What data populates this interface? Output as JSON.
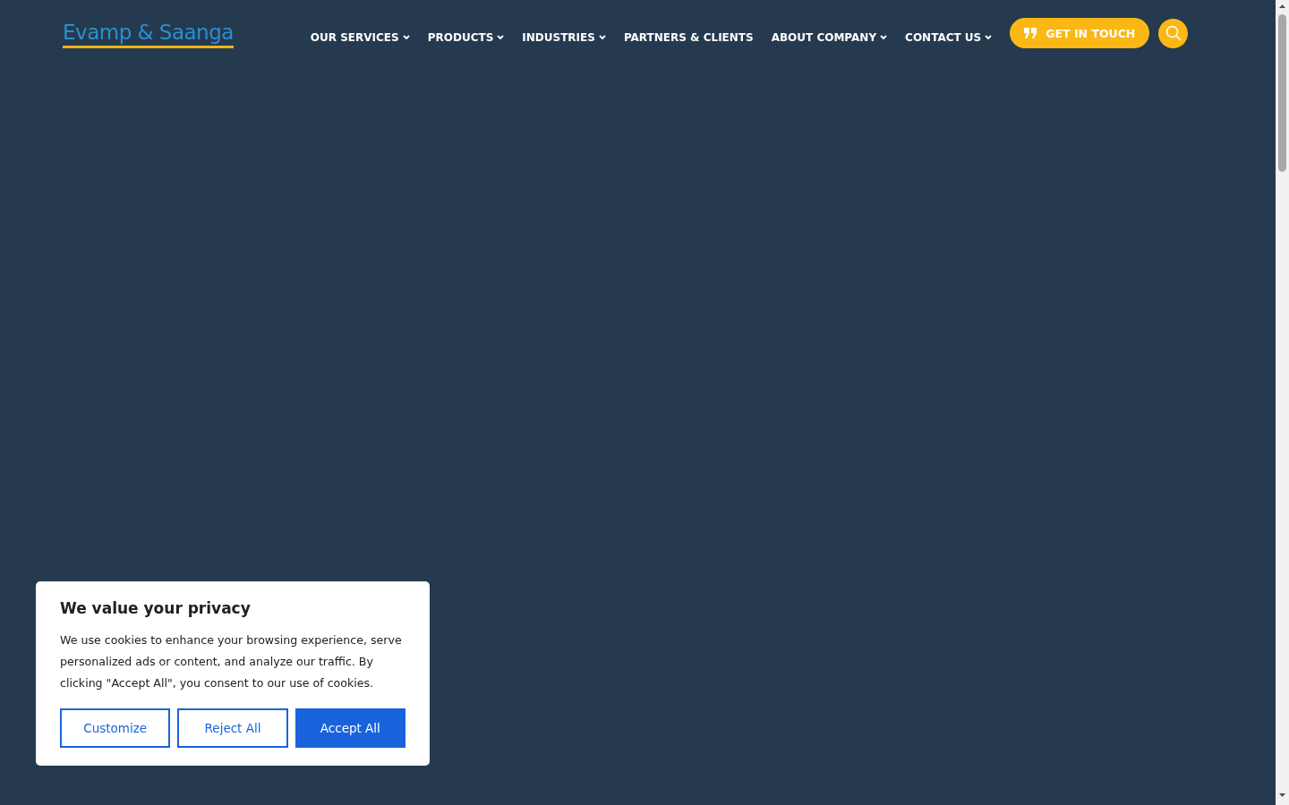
{
  "header": {
    "logo": "Evamp & Saanga",
    "nav": [
      {
        "label": "OUR SERVICES",
        "has_dropdown": true
      },
      {
        "label": "PRODUCTS",
        "has_dropdown": true
      },
      {
        "label": "INDUSTRIES",
        "has_dropdown": true
      },
      {
        "label": "PARTNERS & CLIENTS",
        "has_dropdown": false
      },
      {
        "label": "ABOUT COMPANY",
        "has_dropdown": true
      },
      {
        "label": "CONTACT US",
        "has_dropdown": true
      }
    ],
    "cta": "GET IN TOUCH"
  },
  "cookie_banner": {
    "title": "We value your privacy",
    "text": "We use cookies to enhance your browsing experience, serve personalized ads or content, and analyze our traffic. By clicking \"Accept All\", you consent to our use of cookies.",
    "buttons": [
      {
        "label": "Customize",
        "kind": "outline"
      },
      {
        "label": "Reject All",
        "kind": "outline"
      },
      {
        "label": "Accept All",
        "kind": "primary"
      }
    ]
  }
}
